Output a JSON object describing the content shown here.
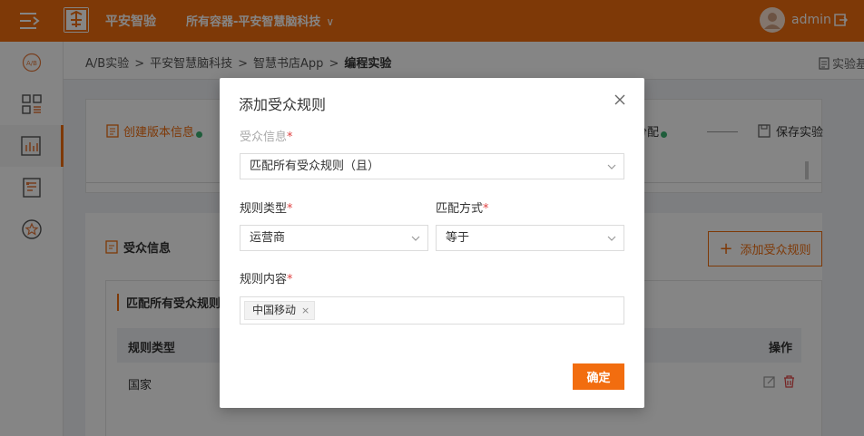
{
  "topbar": {
    "brand": "平安智验",
    "container": "所有容器-平安智慧脑科技",
    "user": "admin"
  },
  "sidebar": {
    "items": [
      {
        "icon": "ab-icon"
      },
      {
        "icon": "grid-list-icon"
      },
      {
        "icon": "bar-chart-icon"
      },
      {
        "icon": "document-list-icon"
      },
      {
        "icon": "star-icon"
      }
    ]
  },
  "breadcrumb": {
    "items": [
      "A/B实验",
      "平安智慧脑科技",
      "智慧书店App",
      "编程实验"
    ],
    "separator": ">",
    "basic_info": "实验基本信息"
  },
  "steps": {
    "create_version": "创建版本信息",
    "traffic": "流量分配",
    "save": "保存实验"
  },
  "audience": {
    "section_title": "受众信息",
    "add_rule": "添加受众规则",
    "add_icon": "+",
    "group_title": "匹配所有受众规则",
    "table": {
      "headers": [
        "规则类型",
        "操作"
      ],
      "rows": [
        {
          "type": "国家"
        }
      ]
    }
  },
  "modal": {
    "title": "添加受众规则",
    "close": "×",
    "audience_label": "受众信息",
    "audience_value": "匹配所有受众规则（且）",
    "rule_type_label": "规则类型",
    "rule_type_value": "运营商",
    "match_label": "匹配方式",
    "match_value": "等于",
    "content_label": "规则内容",
    "content_tags": [
      "中国移动"
    ],
    "tag_remove": "×",
    "required_mark": "*",
    "confirm": "确定"
  },
  "colors": {
    "brand": "#f26d0f",
    "success": "#3cb371",
    "required": "#e04343"
  }
}
